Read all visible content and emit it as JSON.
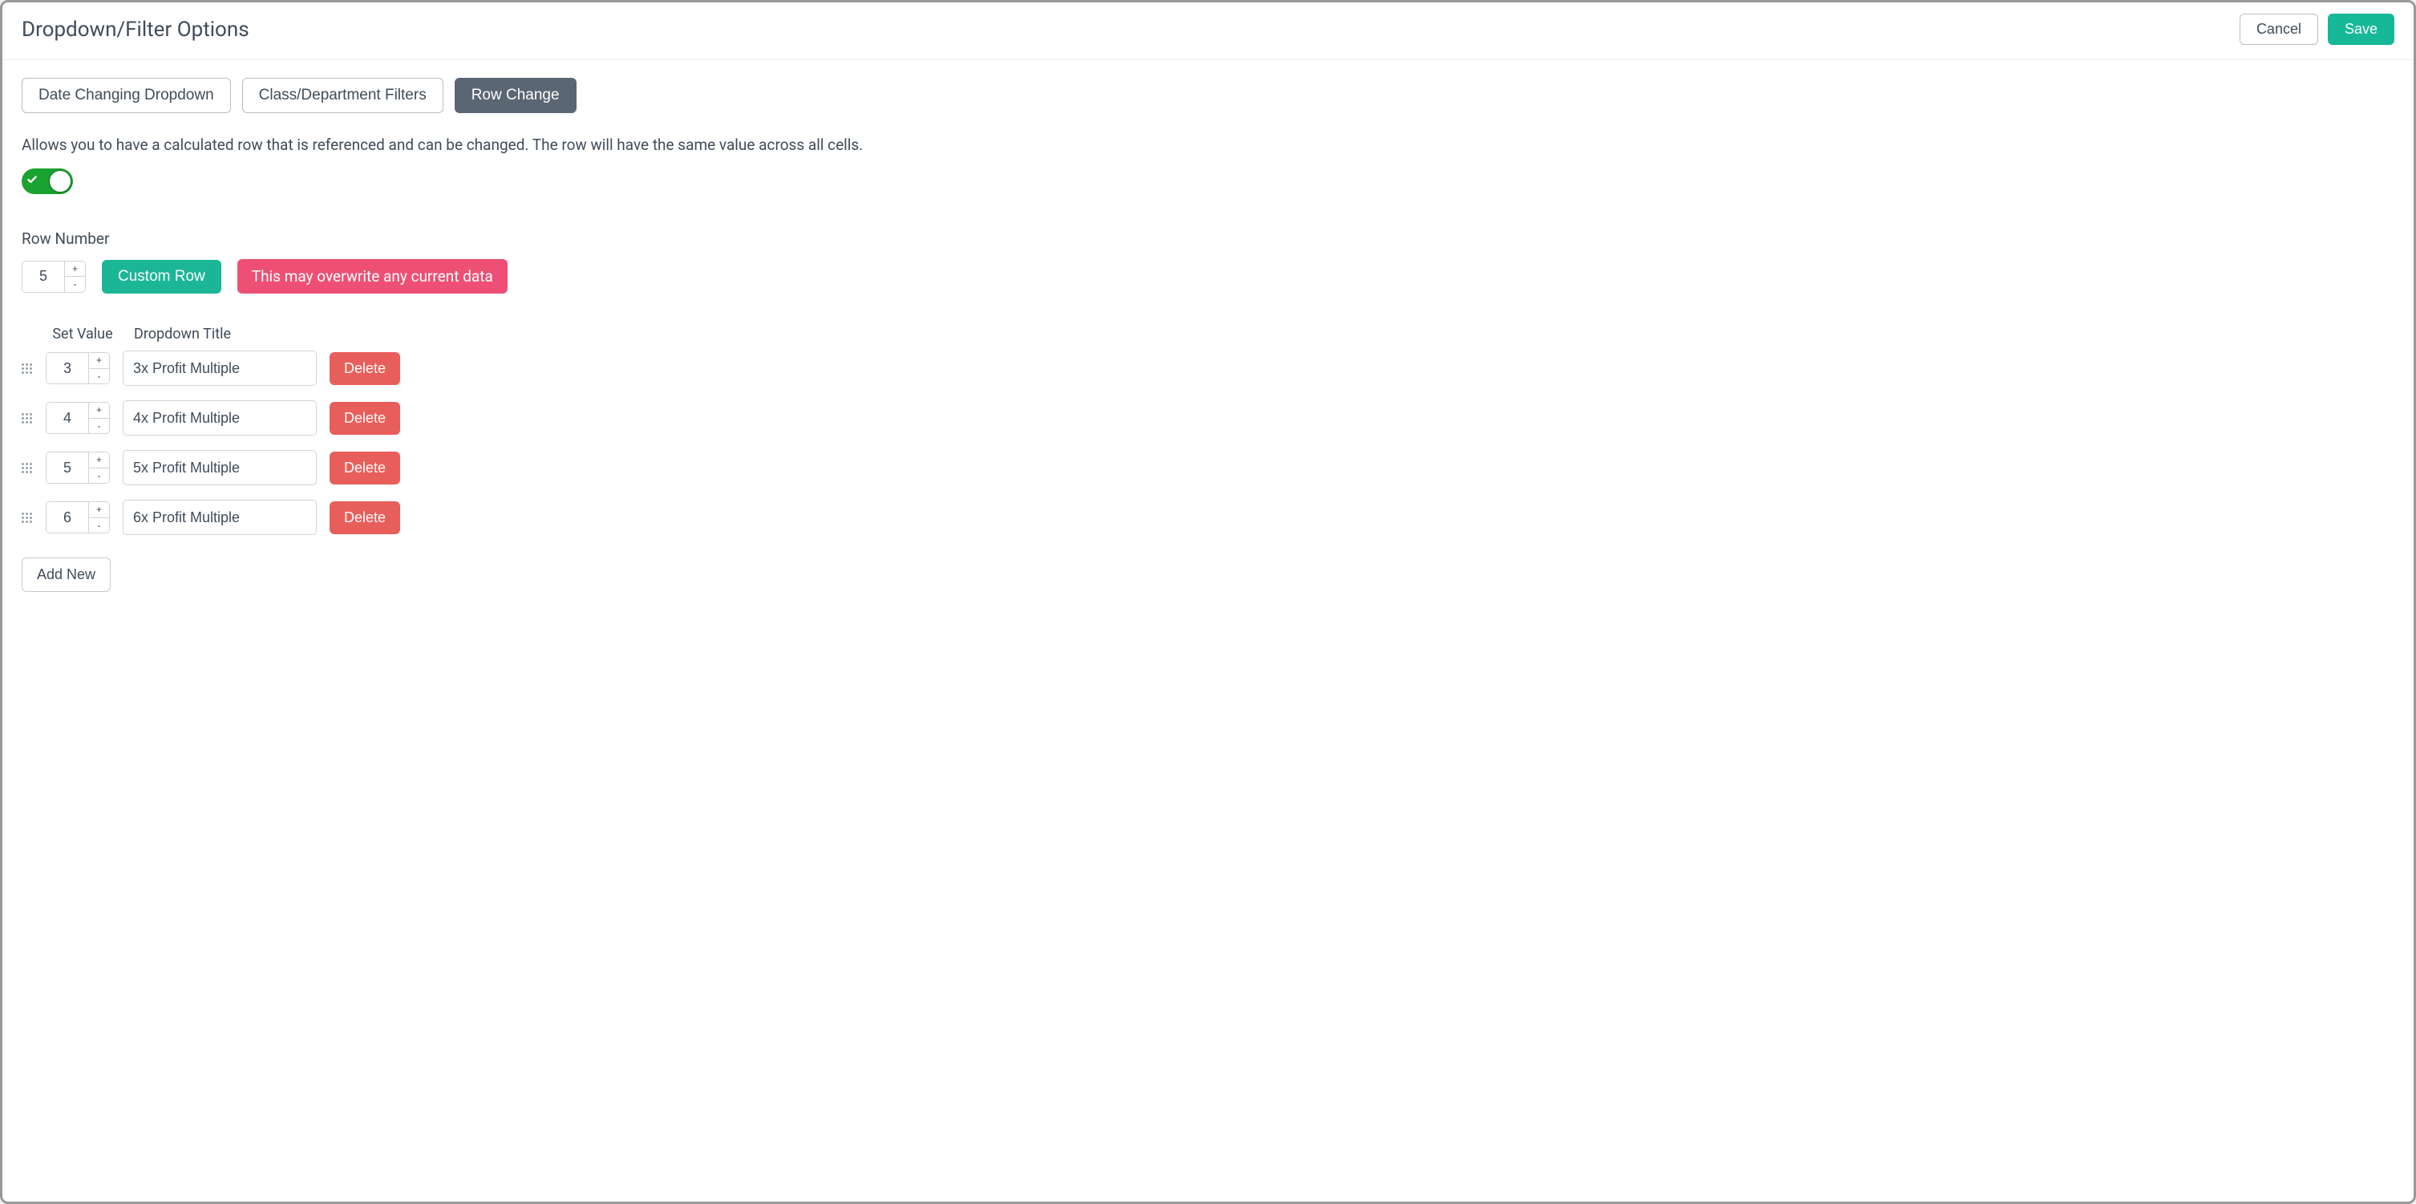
{
  "header": {
    "title": "Dropdown/Filter Options",
    "cancel_label": "Cancel",
    "save_label": "Save"
  },
  "tabs": [
    {
      "label": "Date Changing Dropdown",
      "active": false
    },
    {
      "label": "Class/Department Filters",
      "active": false
    },
    {
      "label": "Row Change",
      "active": true
    }
  ],
  "description": "Allows you to have a calculated row that is referenced and can be changed. The row will have the same value across all cells.",
  "toggle_on": true,
  "row_number": {
    "label": "Row Number",
    "value": "5",
    "custom_row_label": "Custom Row",
    "warning_label": "This may overwrite any current data"
  },
  "columns": {
    "set_value": "Set Value",
    "dropdown_title": "Dropdown Title"
  },
  "options": [
    {
      "value": "3",
      "title": "3x Profit Multiple"
    },
    {
      "value": "4",
      "title": "4x Profit Multiple"
    },
    {
      "value": "5",
      "title": "5x Profit Multiple"
    },
    {
      "value": "6",
      "title": "6x Profit Multiple"
    }
  ],
  "delete_label": "Delete",
  "add_new_label": "Add New"
}
